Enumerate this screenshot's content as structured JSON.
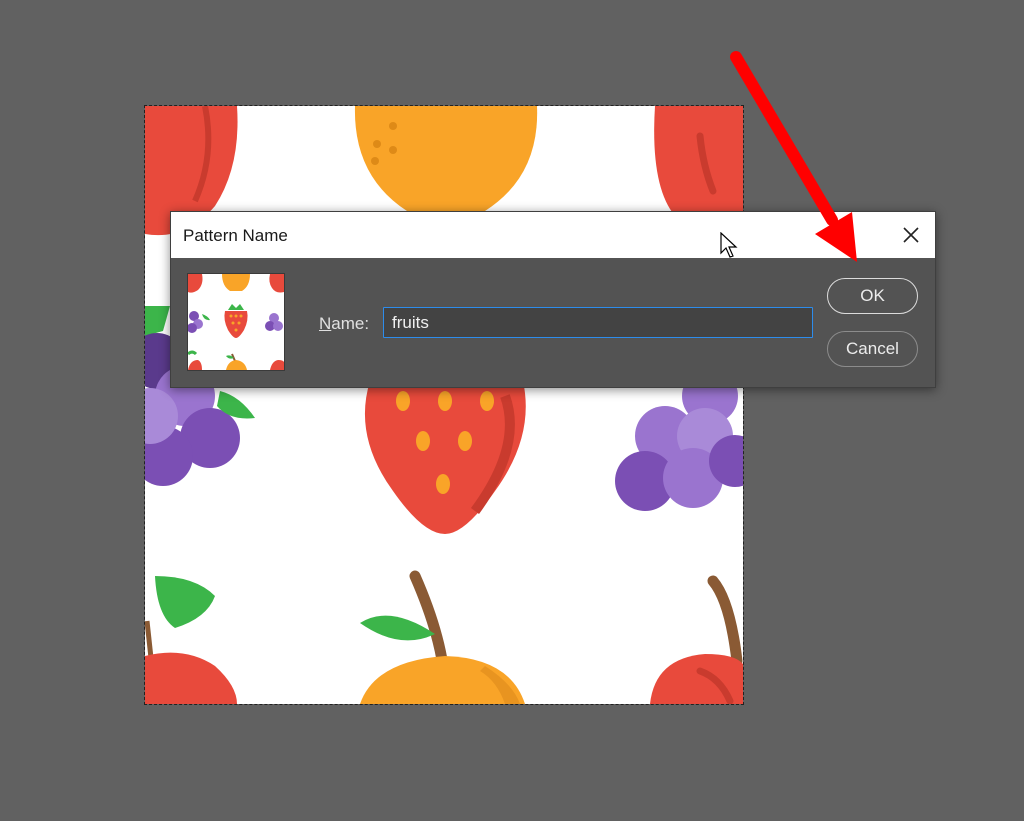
{
  "dialog": {
    "title": "Pattern Name",
    "close_icon": "close-icon",
    "name_label_prefix": "N",
    "name_label_rest": "ame:",
    "name_value": "fruits",
    "ok_label": "OK",
    "cancel_label": "Cancel"
  },
  "colors": {
    "workspace": "#616161",
    "dialog_body": "#535353",
    "input_focus": "#2d8ceb",
    "annotation_arrow": "#ff0000",
    "apple_red": "#e84a3c",
    "orange": "#f9a428",
    "grape_purple": "#7b4fb4",
    "leaf_green": "#3cb54a"
  },
  "icons": {
    "document_art": "fruit-pattern-illustration",
    "cursor": "arrow-cursor-icon",
    "annotation": "red-arrow-annotation-icon"
  }
}
